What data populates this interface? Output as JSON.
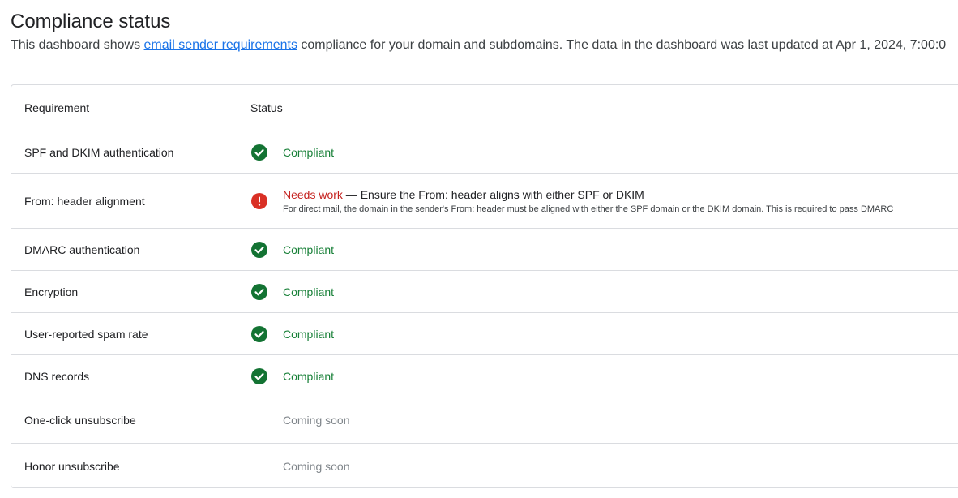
{
  "header": {
    "title": "Compliance status",
    "desc_prefix": "This dashboard shows ",
    "desc_link": "email sender requirements",
    "desc_suffix": " compliance for your domain and subdomains. The data in the dashboard was last updated at Apr 1, 2024, 7:00:0"
  },
  "table": {
    "col_requirement": "Requirement",
    "col_status": "Status",
    "rows": [
      {
        "requirement": "SPF and DKIM authentication",
        "status": "Compliant",
        "state": "ok"
      },
      {
        "requirement": "From: header alignment",
        "status": "Needs work",
        "state": "warn",
        "message": " — Ensure the From: header aligns with either SPF or DKIM",
        "detail": "For direct mail, the domain in the sender's From: header must be aligned with either the SPF domain or the DKIM domain. This is required to pass DMARC"
      },
      {
        "requirement": "DMARC authentication",
        "status": "Compliant",
        "state": "ok"
      },
      {
        "requirement": "Encryption",
        "status": "Compliant",
        "state": "ok"
      },
      {
        "requirement": "User-reported spam rate",
        "status": "Compliant",
        "state": "ok"
      },
      {
        "requirement": "DNS records",
        "status": "Compliant",
        "state": "ok"
      },
      {
        "requirement": "One-click unsubscribe",
        "status": "Coming soon",
        "state": "soon"
      },
      {
        "requirement": "Honor unsubscribe",
        "status": "Coming soon",
        "state": "soon"
      }
    ]
  },
  "colors": {
    "compliant": "#188038",
    "needs_work": "#c5221f",
    "coming_soon": "#80868b",
    "link": "#1a73e8",
    "border": "#dadce0"
  },
  "icons": {
    "ok": "check-circle-icon",
    "warn": "error-circle-icon"
  }
}
